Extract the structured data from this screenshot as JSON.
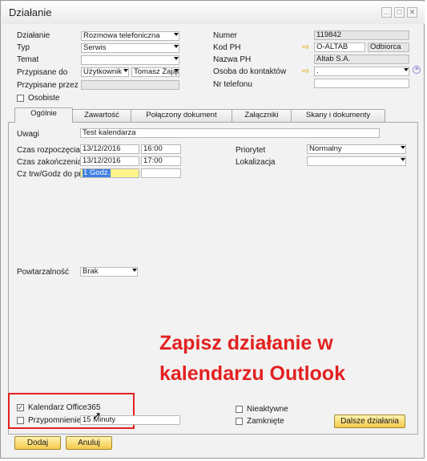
{
  "window": {
    "title": "Działanie",
    "controls": {
      "minimize": "…",
      "maximize": "□",
      "close": "✕"
    }
  },
  "header_left": {
    "dzialanie": {
      "label": "Działanie",
      "value": "Rozmowa telefoniczna"
    },
    "typ": {
      "label": "Typ",
      "value": "Serwis"
    },
    "temat": {
      "label": "Temat",
      "value": ""
    },
    "przypisane_do": {
      "label": "Przypisane do",
      "type_value": "Użytkownik",
      "user_value": "Tomasz Zając"
    },
    "przypisane_przez": {
      "label": "Przypisane przez",
      "value": ""
    },
    "osobiste": {
      "label": "Osobiste"
    }
  },
  "header_right": {
    "numer": {
      "label": "Numer",
      "value": "119842"
    },
    "kod_ph": {
      "label": "Kod PH",
      "value": "O-ALTAB",
      "extra": "Odbiorca"
    },
    "nazwa_ph": {
      "label": "Nazwa PH",
      "value": "Altab S.A."
    },
    "osoba": {
      "label": "Osoba do kontaktów",
      "value": "."
    },
    "nr_telefonu": {
      "label": "Nr telefonu",
      "value": ""
    }
  },
  "tabs": [
    {
      "label": "Ogólnie",
      "active": true
    },
    {
      "label": "Zawartość",
      "active": false
    },
    {
      "label": "Połączony dokument",
      "active": false
    },
    {
      "label": "Załączniki",
      "active": false
    },
    {
      "label": "Skany i dokumenty",
      "active": false
    }
  ],
  "general": {
    "uwagi": {
      "label": "Uwagi",
      "value": "Test kalendarza"
    },
    "czas_rozpoczecia": {
      "label": "Czas rozpoczęcia",
      "date": "13/12/2016",
      "time": "16:00"
    },
    "czas_zakonczenia": {
      "label": "Czas zakończenia",
      "date": "13/12/2016",
      "time": "17:00"
    },
    "czas_trwania": {
      "label": "Cz trw/Godz do pr",
      "value": "1 Godz."
    },
    "priorytet": {
      "label": "Priorytet",
      "value": "Normalny"
    },
    "lokalizacja": {
      "label": "Lokalizacja",
      "value": ""
    },
    "powtarzalnosc": {
      "label": "Powtarzalność",
      "value": "Brak"
    }
  },
  "bottom": {
    "kalendarz": {
      "label": "Kalendarz Office365",
      "checked": true
    },
    "przypomnienie": {
      "label": "Przypomnienie",
      "value": "15 Minuty",
      "checked": false
    },
    "nieaktywne": {
      "label": "Nieaktywne",
      "checked": false
    },
    "zamkniete": {
      "label": "Zamknięte",
      "checked": false
    },
    "dalsze_dzialania": "Dalsze działania"
  },
  "footer": {
    "dodaj": "Dodaj",
    "anuluj": "Anuluj"
  },
  "annotation": {
    "line1": "Zapisz działanie w",
    "line2": "kalendarzu Outlook"
  },
  "colors": {
    "accent_button": "#f5c94a",
    "annotation_red": "#e32020",
    "selection_blue": "#3d7fe0"
  }
}
